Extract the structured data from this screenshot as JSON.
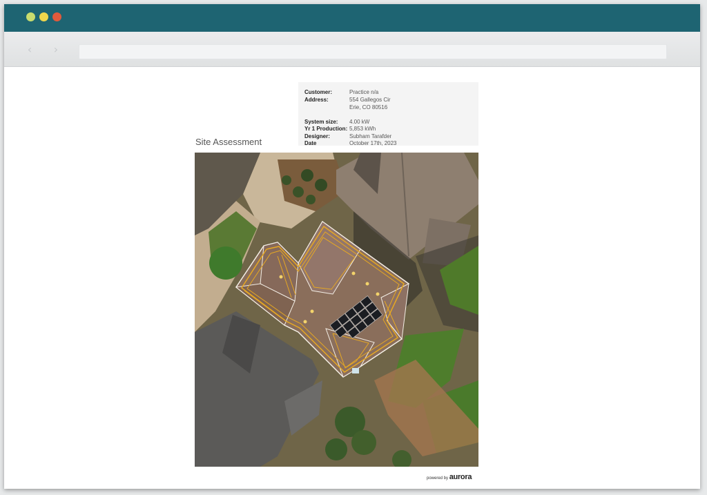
{
  "window": {
    "controls": [
      "close",
      "minimize",
      "maximize"
    ],
    "url": ""
  },
  "report": {
    "info": [
      {
        "label": "Customer:",
        "value": "Practice n/a"
      },
      {
        "label": "Address:",
        "value": "554 Gallegos Cir"
      },
      {
        "label": "",
        "value": "Erie, CO 80516"
      },
      {
        "label": "System size:",
        "value": "4.00 kW"
      },
      {
        "label": "Yr 1 Production:",
        "value": "5,853 kWh"
      },
      {
        "label": "Designer:",
        "value": "Subham Tarafder"
      },
      {
        "label": "Date",
        "value": "October 17th, 2023"
      }
    ],
    "section_title": "Site Assessment",
    "image": {
      "subject": "aerial-roof-site-image",
      "panel_count": 14
    },
    "footer": {
      "prefix": "powered by",
      "brand": "aurora"
    }
  },
  "colors": {
    "titlebar": "#1e6472",
    "roof_outline": "#e6a823",
    "panel": "#1b1d22"
  }
}
